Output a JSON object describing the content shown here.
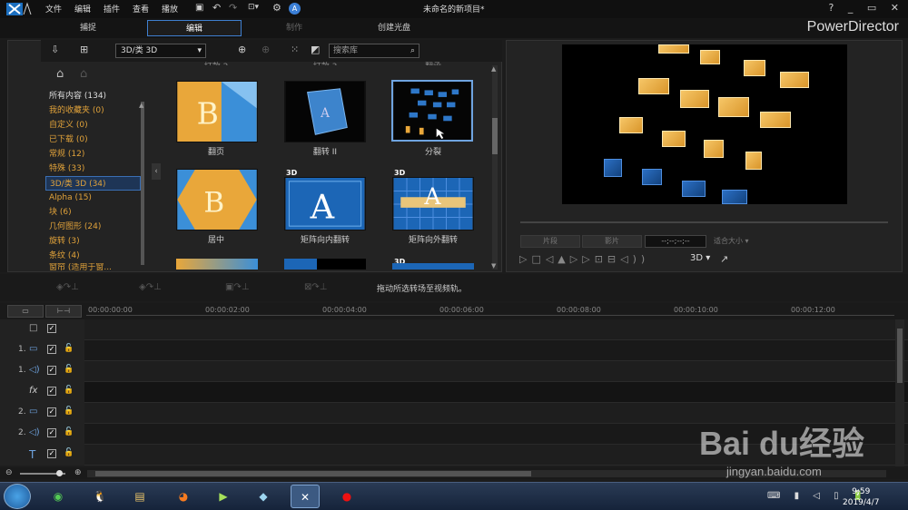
{
  "menu": {
    "items": [
      "文件",
      "编辑",
      "插件",
      "查看",
      "播放"
    ],
    "title": "未命名的新项目*"
  },
  "tabs": [
    {
      "label": "捕捉"
    },
    {
      "label": "编辑"
    },
    {
      "label": "制作"
    },
    {
      "label": "创建光盘"
    }
  ],
  "brand": "PowerDirector",
  "library": {
    "category_select": "3D/类 3D",
    "search_placeholder": "搜索库",
    "categories": [
      "所有内容 (134)",
      "我的收藏夹 (0)",
      "自定义 (0)",
      "已下载 (0)",
      "常规 (12)",
      "特殊 (33)",
      "3D/类 3D (34)",
      "Alpha (15)",
      "块 (6)",
      "几何图形 (24)",
      "旋转 (3)",
      "条纹 (4)",
      "窗帘 (适用于窗..."
    ],
    "top_partial_labels": [
      "打款 2",
      "打款 3",
      "翻函"
    ],
    "items": [
      {
        "label": "翻页",
        "badge": ""
      },
      {
        "label": "翻转 II",
        "badge": ""
      },
      {
        "label": "分裂",
        "badge": ""
      },
      {
        "label": "居中",
        "badge": ""
      },
      {
        "label": "矩阵向内翻转",
        "badge": "3D"
      },
      {
        "label": "矩阵向外翻转",
        "badge": "3D"
      }
    ],
    "bottom_badges": [
      "3D"
    ]
  },
  "preview": {
    "btn_clip": "片段",
    "btn_movie": "影片",
    "timecode": "--;--;--;--",
    "fit": "适合大小",
    "mode": "3D"
  },
  "midbar": {
    "hint": "拖动所选转场至视频轨。"
  },
  "timeline": {
    "ticks": [
      "00:00:00:00",
      "00:00:02:00",
      "00:00:04:00",
      "00:00:06:00",
      "00:00:08:00",
      "00:00:10:00",
      "00:00:12:00"
    ],
    "tracks": [
      {
        "num": "",
        "icon": "master-icon"
      },
      {
        "num": "1.",
        "icon": "video-track-icon"
      },
      {
        "num": "1.",
        "icon": "audio-track-icon"
      },
      {
        "num": "",
        "icon": "fx-track-icon"
      },
      {
        "num": "2.",
        "icon": "video-track-icon"
      },
      {
        "num": "2.",
        "icon": "audio-track-icon"
      },
      {
        "num": "",
        "icon": "title-track-icon"
      }
    ]
  },
  "taskbar": {
    "time": "9:59",
    "date": "2019/4/7"
  },
  "watermark": {
    "text": "Bai du经验",
    "url": "jingyan.baidu.com"
  }
}
